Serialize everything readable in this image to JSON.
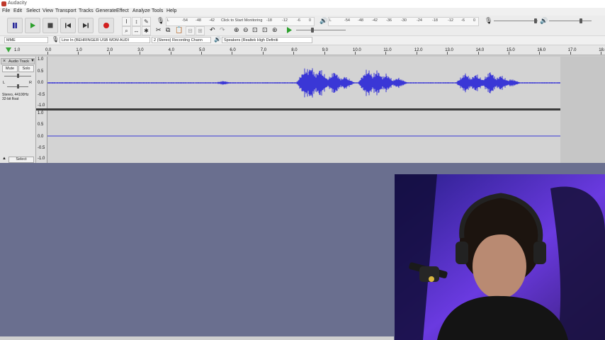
{
  "window": {
    "title": "Audacity"
  },
  "menu": [
    "File",
    "Edit",
    "Select",
    "View",
    "Transport",
    "Tracks",
    "Generate",
    "Effect",
    "Analyze",
    "Tools",
    "Help"
  ],
  "meters": {
    "record_prompt": "Click to Start Monitoring",
    "record_ticks": [
      "-54",
      "-48",
      "-42",
      "-18",
      "-12",
      "-6",
      "0"
    ],
    "play_ticks": [
      "-54",
      "-48",
      "-42",
      "-36",
      "-30",
      "-24",
      "-18",
      "-12",
      "-6",
      "0"
    ]
  },
  "device": {
    "host": "MME",
    "input": "Line In (BEHRINGER USB WDM AUDI",
    "channels": "2 (Stereo) Recording Chann",
    "output": "Speakers (Realtek High Definiti"
  },
  "ruler": {
    "left_label": "1.0",
    "labels": [
      "0.0",
      "1.0",
      "2.0",
      "3.0",
      "4.0",
      "5.0",
      "6.0",
      "7.0",
      "8.0",
      "9.0",
      "10.0",
      "11.0",
      "12.0",
      "13.0",
      "14.0",
      "15.0",
      "16.0",
      "17.0",
      "18.0"
    ]
  },
  "track": {
    "name": "Audio Track",
    "mute": "Mute",
    "solo": "Solo",
    "pan_left": "L",
    "pan_right": "R",
    "format_line1": "Stereo, 44100Hz",
    "format_line2": "32-bit float",
    "select": "Select",
    "scale": [
      "1.0",
      "0.5",
      "0.0",
      "-0.5",
      "-1.0"
    ]
  },
  "colors": {
    "waveform": "#3a37d6",
    "track_bg": "#d3d3d3",
    "desktop": "#6a6f8f"
  }
}
